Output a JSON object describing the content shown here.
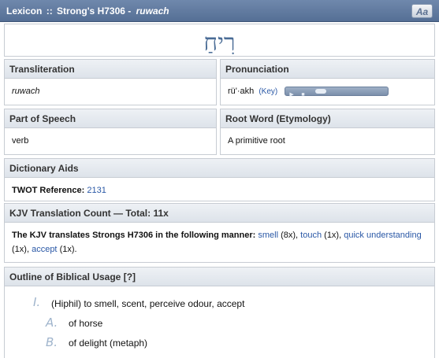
{
  "titlebar": {
    "prefix": "Lexicon",
    "separator": "::",
    "strongs": "Strong's H7306",
    "dash": "-",
    "translit": "ruwach",
    "font_button": "Aa"
  },
  "word": {
    "hebrew": "רִיחַ"
  },
  "transliteration": {
    "heading": "Transliteration",
    "value": "ruwach"
  },
  "pronunciation": {
    "heading": "Pronunciation",
    "value": "rü'·akh",
    "key_label": "(Key)",
    "player": {
      "play_icon": "play-icon",
      "stop_icon": "stop-icon"
    }
  },
  "part_of_speech": {
    "heading": "Part of Speech",
    "value": "verb"
  },
  "root_word": {
    "heading": "Root Word (Etymology)",
    "value": "A primitive root"
  },
  "dictionary_aids": {
    "heading": "Dictionary Aids",
    "label": "TWOT Reference:",
    "value": "2131"
  },
  "kjv": {
    "heading": "KJV Translation Count — Total: 11x",
    "intro": "The KJV translates Strongs H7306 in the following manner:",
    "items": [
      {
        "word": "smell",
        "count": "(8x)",
        "sep": ","
      },
      {
        "word": "touch",
        "count": "(1x)",
        "sep": ","
      },
      {
        "word": "quick understanding",
        "count": "(1x)",
        "sep": ","
      },
      {
        "word": "accept",
        "count": "(1x)",
        "sep": "."
      }
    ]
  },
  "outline": {
    "heading": "Outline of Biblical Usage [?]",
    "items": [
      {
        "numeral": "I.",
        "text": "(Hiphil) to smell, scent, perceive odour, accept"
      },
      {
        "numeral": "A.",
        "text": "of horse"
      },
      {
        "numeral": "B.",
        "text": "of delight (metaph)"
      }
    ]
  },
  "colors": {
    "titlebar": "#5d77a0",
    "link": "#2a58a6",
    "hebrew": "#4a6c96",
    "numeral": "#9fb4cc",
    "panel_header": "#e3e8ee"
  }
}
